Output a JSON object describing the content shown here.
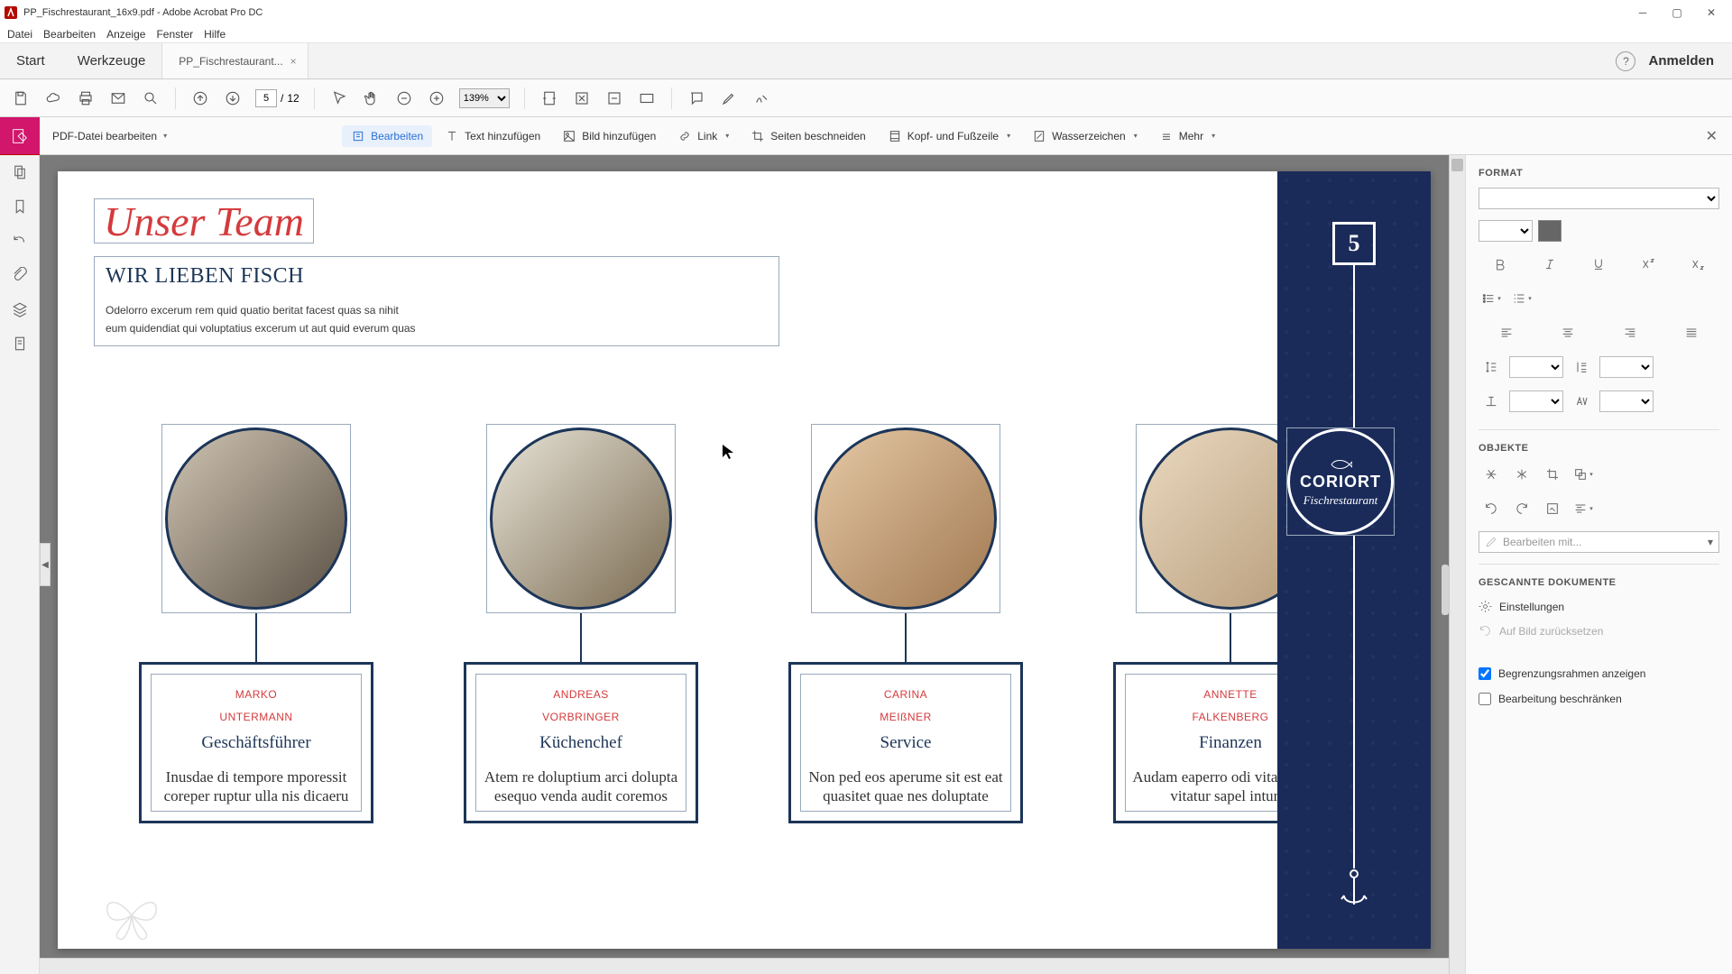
{
  "titlebar": {
    "title": "PP_Fischrestaurant_16x9.pdf - Adobe Acrobat Pro DC"
  },
  "menubar": {
    "items": [
      "Datei",
      "Bearbeiten",
      "Anzeige",
      "Fenster",
      "Hilfe"
    ]
  },
  "tabs": {
    "start": "Start",
    "tools": "Werkzeuge",
    "doc": "PP_Fischrestaurant...",
    "login": "Anmelden"
  },
  "maintb": {
    "page_current": "5",
    "page_sep": "/",
    "page_total": "12",
    "zoom": "139%"
  },
  "edittb": {
    "title": "PDF-Datei bearbeiten",
    "edit": "Bearbeiten",
    "addtext": "Text hinzufügen",
    "addimg": "Bild hinzufügen",
    "link": "Link",
    "crop": "Seiten beschneiden",
    "header": "Kopf- und Fußzeile",
    "wm": "Wasserzeichen",
    "more": "Mehr"
  },
  "doc": {
    "script_title": "Unser Team",
    "heading": "WIR LIEBEN FISCH",
    "body1": "Odelorro excerum rem quid quatio beritat facest quas sa nihit",
    "body2": "eum quidendiat qui voluptatius excerum ut aut quid everum quas",
    "page_number": "5",
    "logo1": "CORIORT",
    "logo2": "Fischrestaurant",
    "members": [
      {
        "name_l1": "MARKO",
        "name_l2": "UNTERMANN",
        "role": "Geschäftsführer",
        "desc": "Inusdae di tempore mporessit coreper ruptur ulla nis dicaeru"
      },
      {
        "name_l1": "ANDREAS",
        "name_l2": "VORBRINGER",
        "role": "Küchenchef",
        "desc": "Atem re doluptium arci dolupta esequo venda audit coremos"
      },
      {
        "name_l1": "CARINA",
        "name_l2": "MEIßNER",
        "role": "Service",
        "desc": "Non ped eos aperume sit est eat quasitet quae nes doluptate"
      },
      {
        "name_l1": "ANNETTE",
        "name_l2": "FALKENBERG",
        "role": "Finanzen",
        "desc": "Audam eaperro odi vitatio blam vitatur sapel inturio"
      }
    ]
  },
  "rightpanel": {
    "format": "FORMAT",
    "objects": "OBJEKTE",
    "editwith": "Bearbeiten mit...",
    "scanned": "GESCANNTE DOKUMENTE",
    "settings": "Einstellungen",
    "resetimg": "Auf Bild zurücksetzen",
    "showbbox": "Begrenzungsrahmen anzeigen",
    "restrict": "Bearbeitung beschränken"
  }
}
